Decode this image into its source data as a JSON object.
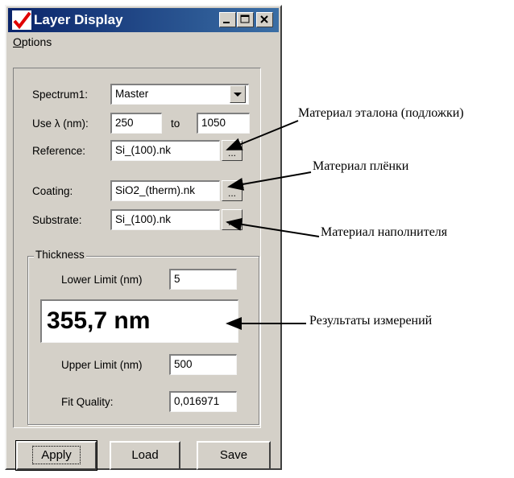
{
  "window": {
    "title": "Layer Display"
  },
  "menu": {
    "options": "Options"
  },
  "form": {
    "spectrum_label": "Spectrum1:",
    "spectrum_value": "Master",
    "use_label": "Use λ (nm):",
    "range_from": "250",
    "to_label": "to",
    "range_to": "1050",
    "reference_label": "Reference:",
    "reference_value": "Si_(100).nk",
    "coating_label": "Coating:",
    "coating_value": "SiO2_(therm).nk",
    "substrate_label": "Substrate:",
    "substrate_value": "Si_(100).nk",
    "browse_label": "..."
  },
  "thickness": {
    "group_title": "Thickness",
    "lower_label": "Lower Limit (nm)",
    "lower_value": "5",
    "result": "355,7 nm",
    "upper_label": "Upper Limit (nm)",
    "upper_value": "500",
    "fit_label": "Fit Quality:",
    "fit_value": "0,016971"
  },
  "buttons": {
    "apply": "Apply",
    "load": "Load",
    "save": "Save"
  },
  "annotations": {
    "reference": "Материал эталона (подложки)",
    "coating": "Материал плёнки",
    "substrate": "Материал наполнителя",
    "results": "Результаты измерений"
  },
  "colors": {
    "titlebar_start": "#0a246a",
    "titlebar_end": "#3a6ea5",
    "window_bg": "#d4d0c8",
    "icon_check": "#e00000"
  },
  "icons": {
    "app": "red-check-icon",
    "minimize": "minimize-icon",
    "maximize": "maximize-icon",
    "close": "close-icon",
    "dropdown": "dropdown-arrow-icon"
  }
}
